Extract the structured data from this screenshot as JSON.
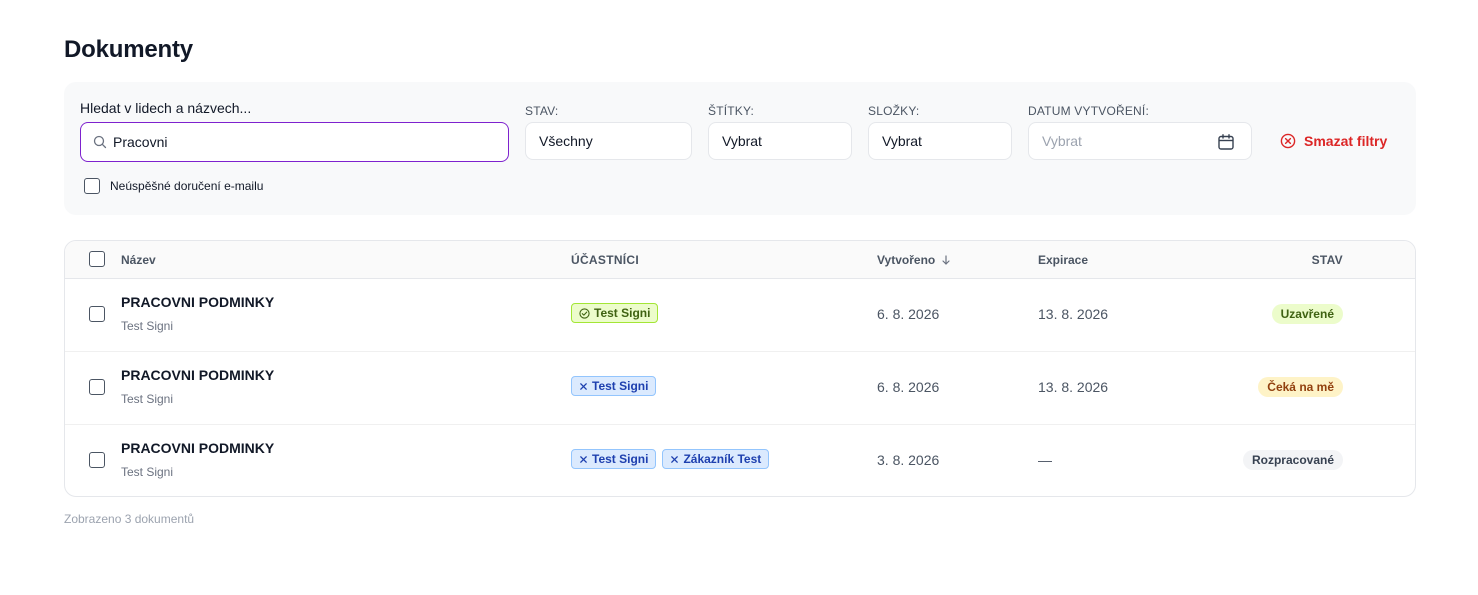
{
  "page": {
    "title": "Dokumenty"
  },
  "filters": {
    "search_label": "Hledat v lidech a názvech...",
    "search_value": "Pracovni",
    "status_label": "STAV:",
    "status_value": "Všechny",
    "tags_label": "ŠTÍTKY:",
    "tags_value": "Vybrat",
    "folders_label": "SLOŽKY:",
    "folders_value": "Vybrat",
    "date_label": "DATUM VYTVOŘENÍ:",
    "date_placeholder": "Vybrat",
    "clear_label": "Smazat filtry",
    "email_failed_label": "Neúspěšné doručení e-mailu"
  },
  "table": {
    "headers": {
      "name": "Název",
      "participants": "ÚČASTNÍCI",
      "created": "Vytvořeno",
      "expiration": "Expirace",
      "status": "STAV"
    },
    "rows": [
      {
        "title": "PRACOVNI PODMINKY",
        "owner": "Test Signi",
        "participants": [
          {
            "name": "Test Signi",
            "state": "signed"
          }
        ],
        "created": "6. 8. 2026",
        "expiration": "13. 8. 2026",
        "status": "Uzavřené"
      },
      {
        "title": "PRACOVNI PODMINKY",
        "owner": "Test Signi",
        "participants": [
          {
            "name": "Test Signi",
            "state": "pending"
          }
        ],
        "created": "6. 8. 2026",
        "expiration": "13. 8. 2026",
        "status": "Čeká na mě"
      },
      {
        "title": "PRACOVNI PODMINKY",
        "owner": "Test Signi",
        "participants": [
          {
            "name": "Test Signi",
            "state": "pending"
          },
          {
            "name": "Zákazník Test",
            "state": "pending"
          }
        ],
        "created": "3. 8. 2026",
        "expiration": "—",
        "status": "Rozpracované"
      }
    ]
  },
  "footer": {
    "count_text": "Zobrazeno 3 dokumentů"
  },
  "icons": {
    "search": "search-icon",
    "calendar": "calendar-icon",
    "clear": "x-circle-icon",
    "sort": "arrow-down-icon",
    "signed": "check-circle-icon",
    "pending": "x-icon"
  },
  "colors": {
    "accent": "#7e22ce",
    "danger": "#dc2626",
    "signed_bg": "#ecfccb",
    "pending_bg": "#dbeafe",
    "waiting_bg": "#fef3c7",
    "draft_bg": "#f3f4f6"
  }
}
